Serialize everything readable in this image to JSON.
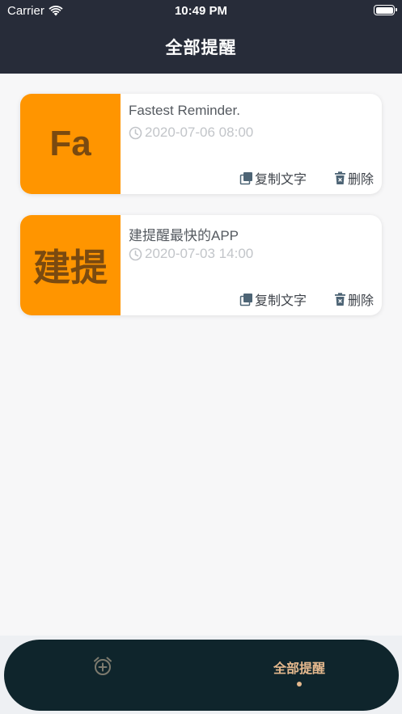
{
  "status_bar": {
    "carrier": "Carrier",
    "time": "10:49 PM"
  },
  "header": {
    "title": "全部提醒"
  },
  "reminders": [
    {
      "thumb": "Fa",
      "title": "Fastest Reminder.",
      "date": "2020-07-06 08:00",
      "copy_label": "复制文字",
      "delete_label": "删除"
    },
    {
      "thumb": "建提",
      "title": "建提醒最快的APP",
      "date": "2020-07-03 14:00",
      "copy_label": "复制文字",
      "delete_label": "删除"
    }
  ],
  "tabbar": {
    "all_label": "全部提醒",
    "icons": [
      "alarm-add-icon"
    ]
  },
  "colors": {
    "header_bg": "#272c39",
    "thumb_bg": "#ff9500",
    "tabbar_bg": "#0f252c",
    "tab_active": "#e5b98e"
  }
}
